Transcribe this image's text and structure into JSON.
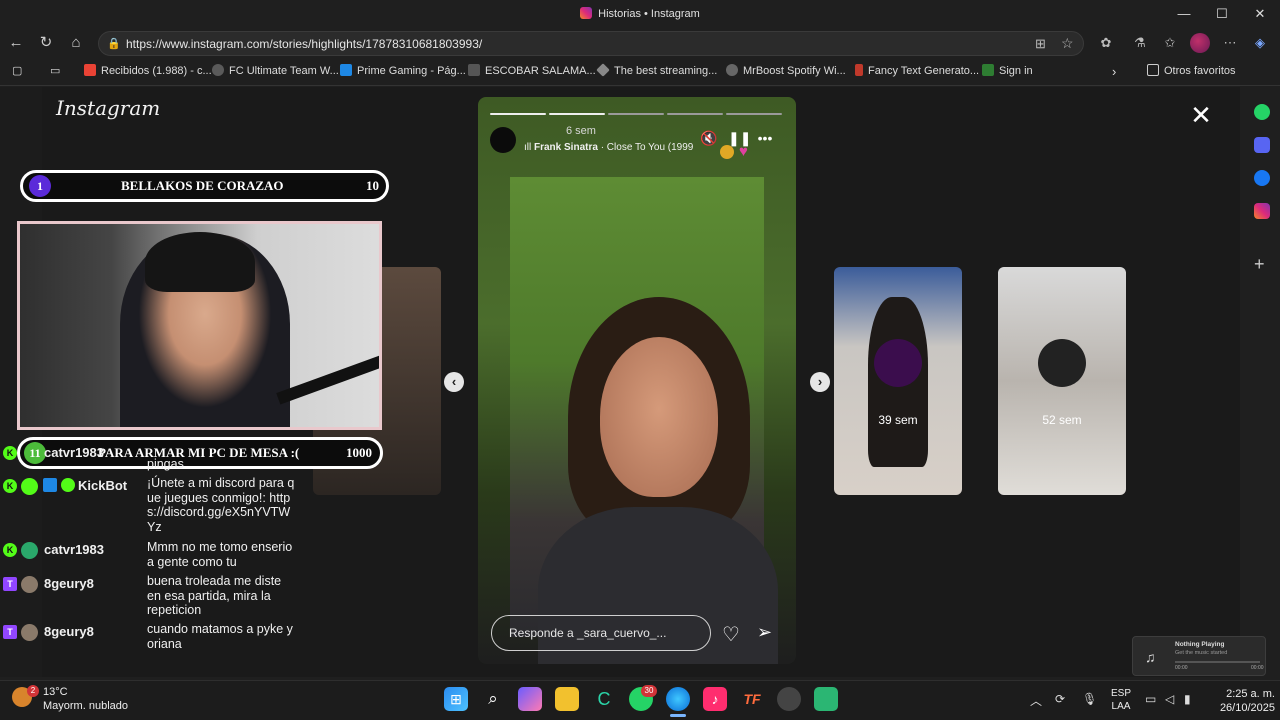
{
  "window": {
    "title": "Historias • Instagram",
    "minimize": "—",
    "maximize": "☐",
    "close": "✕"
  },
  "address": {
    "url": "https://www.instagram.com/stories/highlights/17878310681803993/"
  },
  "bookmarks": {
    "items": [
      {
        "label": "Recibidos (1.988) - c...",
        "color": "#ea4335"
      },
      {
        "label": "FC Ultimate Team W...",
        "color": "#5a5a5a"
      },
      {
        "label": "Prime Gaming - Pág...",
        "color": "#1e88e5"
      },
      {
        "label": "ESCOBAR SALAMA...",
        "color": "#555555"
      },
      {
        "label": "The best streaming...",
        "color": "#888888"
      },
      {
        "label": "MrBoost Spotify Wi...",
        "color": "#666666"
      },
      {
        "label": "Fancy Text Generato...",
        "color": "#c0392b"
      },
      {
        "label": "Sign in",
        "color": "#2e7d32"
      }
    ],
    "other": "Otros favoritos"
  },
  "instagram": {
    "logo": "Instagram"
  },
  "story": {
    "time": "6 sem",
    "song_artist": "Frank Sinatra",
    "song_title": " · Close To You (1999",
    "reply_placeholder": "Responde a _sara_cuervo_..."
  },
  "side_stories": {
    "next1_time": "39 sem",
    "next2_time": "52 sem"
  },
  "overlay": {
    "banner_top": {
      "rank": "1",
      "text": "BELLAKOS DE CORAZAO",
      "goal": "10"
    },
    "banner_bottom": {
      "rank": "11",
      "text": "PARA ARMAR MI PC DE MESA :(",
      "goal": "1000"
    }
  },
  "chat": [
    {
      "user": "catvr1983",
      "message": "pingas",
      "platform": "kick"
    },
    {
      "user": "KickBot",
      "message": "¡Únete a mi discord para que juegues conmigo!: https://discord.gg/eX5nYVTWYz",
      "platform": "kick"
    },
    {
      "user": "catvr1983",
      "message": "Mmm no me tomo enserio a gente como tu",
      "platform": "kick"
    },
    {
      "user": "8geury8",
      "message": "buena troleada me diste en esa partida, mira la repeticion",
      "platform": "twitch"
    },
    {
      "user": "8geury8",
      "message": "cuando matamos a pyke y oriana",
      "platform": "twitch"
    }
  ],
  "media_widget": {
    "title": "Nothing Playing",
    "subtitle": "Get the music started",
    "start": "00:00",
    "end": "00:00"
  },
  "taskbar": {
    "weather_temp": "13°C",
    "weather_desc": "Mayorm. nublado",
    "weather_badge": "2",
    "whatsapp_badge": "30",
    "lang_1": "ESP",
    "lang_2": "LAA",
    "time": "2:25 a. m.",
    "date": "26/10/2025"
  }
}
